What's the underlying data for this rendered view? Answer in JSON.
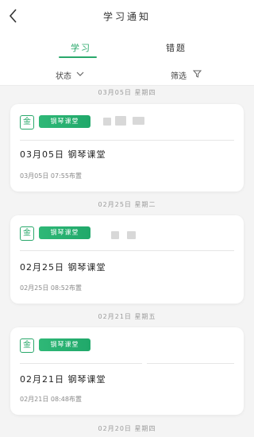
{
  "header": {
    "title": "学习通知",
    "back_label": "<"
  },
  "tabs": [
    {
      "label": "学习",
      "active": true
    },
    {
      "label": "错题",
      "active": false
    }
  ],
  "filters": {
    "status_label": "状态",
    "screen_label": "筛选"
  },
  "colors": {
    "accent": "#2aa86b",
    "background": "#f4f4f4"
  },
  "date_separators": [
    "03月05日 星期四",
    "02月25日 星期二",
    "02月21日 星期五",
    "02月20日 星期四"
  ],
  "cards": [
    {
      "badge": "金",
      "tag": "钢琴课堂",
      "title": "03月05日 钢琴课堂",
      "subtitle": "03月05日 07:55布置"
    },
    {
      "badge": "金",
      "tag": "钢琴课堂",
      "title": "02月25日 钢琴课堂",
      "subtitle": "02月25日 08:52布置"
    },
    {
      "badge": "金",
      "tag": "钢琴课堂",
      "title": "02月21日 钢琴课堂",
      "subtitle": "02月21日 08:48布置"
    }
  ]
}
